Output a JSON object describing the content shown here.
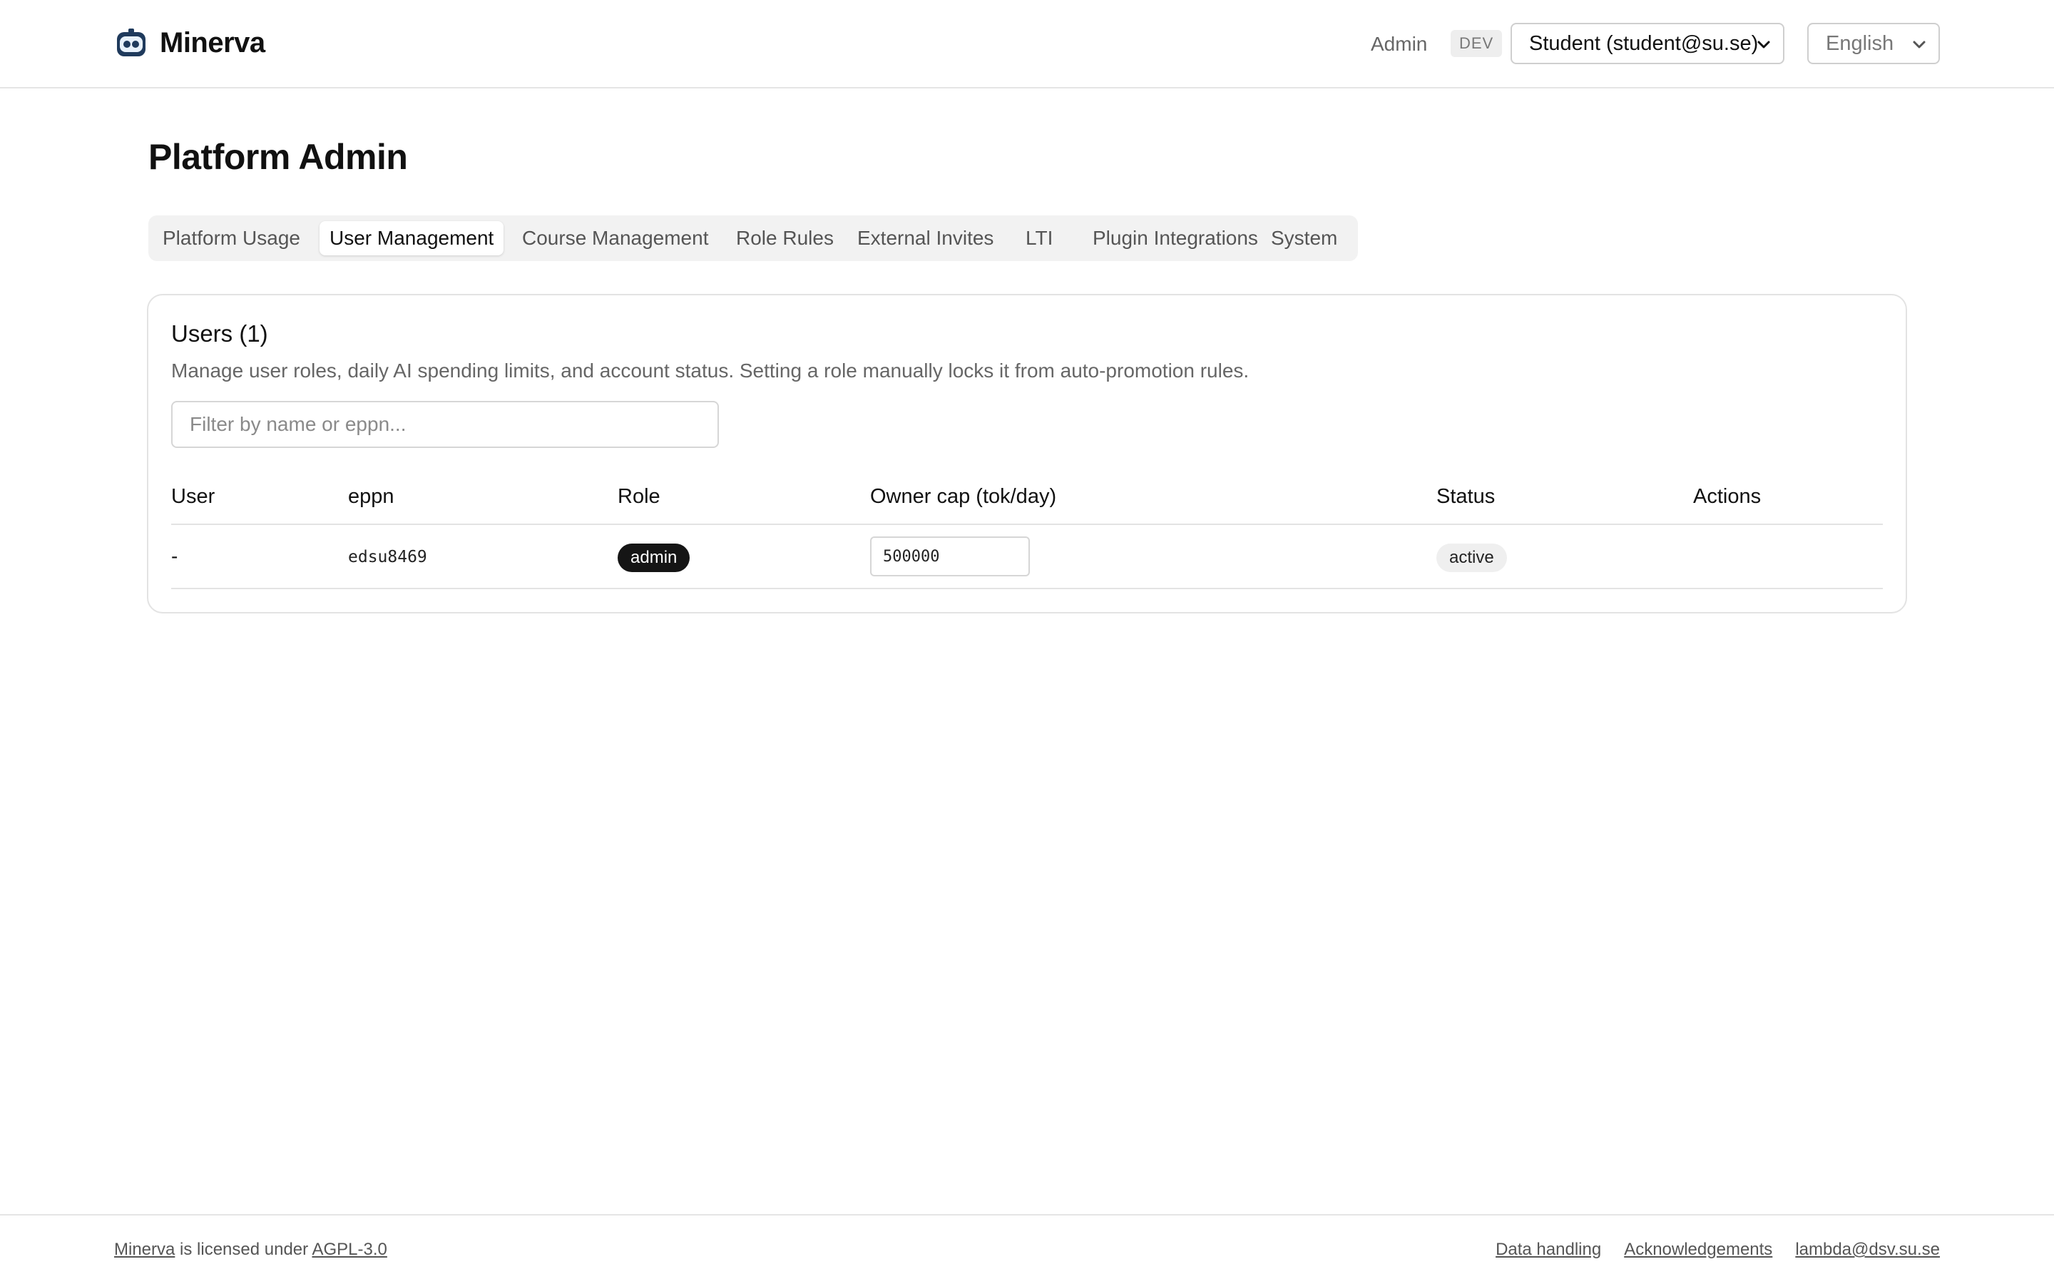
{
  "header": {
    "brand_name": "Minerva",
    "admin_link": "Admin",
    "env_badge": "DEV",
    "user_select_value": "Student (student@su.se)",
    "language_select_value": "English"
  },
  "page": {
    "title": "Platform Admin",
    "tabs": [
      {
        "label": "Platform Usage",
        "active": false
      },
      {
        "label": "User Management",
        "active": true
      },
      {
        "label": "Course Management",
        "active": false
      },
      {
        "label": "Role Rules",
        "active": false
      },
      {
        "label": "External Invites",
        "active": false
      },
      {
        "label": "LTI",
        "active": false
      },
      {
        "label": "Plugin Integrations",
        "active": false
      },
      {
        "label": "System",
        "active": false
      }
    ]
  },
  "users_card": {
    "title": "Users (1)",
    "description": "Manage user roles, daily AI spending limits, and account status. Setting a role manually locks it from auto-promotion rules.",
    "filter_placeholder": "Filter by name or eppn...",
    "columns": [
      "User",
      "eppn",
      "Role",
      "Owner cap (tok/day)",
      "Status",
      "Actions"
    ],
    "rows": [
      {
        "user": "-",
        "eppn": "edsu8469",
        "role": "admin",
        "owner_cap": "500000",
        "status": "active",
        "actions": ""
      }
    ]
  },
  "footer": {
    "minerva_link": "Minerva",
    "licensed_text": " is licensed under ",
    "license_link": "AGPL-3.0",
    "links": [
      "Data handling",
      "Acknowledgements",
      "lambda@dsv.su.se"
    ]
  },
  "colors": {
    "accent_dark": "#151515",
    "border": "#e3e3e3",
    "muted_text": "#666666",
    "logo_blue": "#1f3a5c"
  },
  "icons": {
    "logo": "robot-face-icon",
    "select_chevron": "chevron-down-icon"
  }
}
